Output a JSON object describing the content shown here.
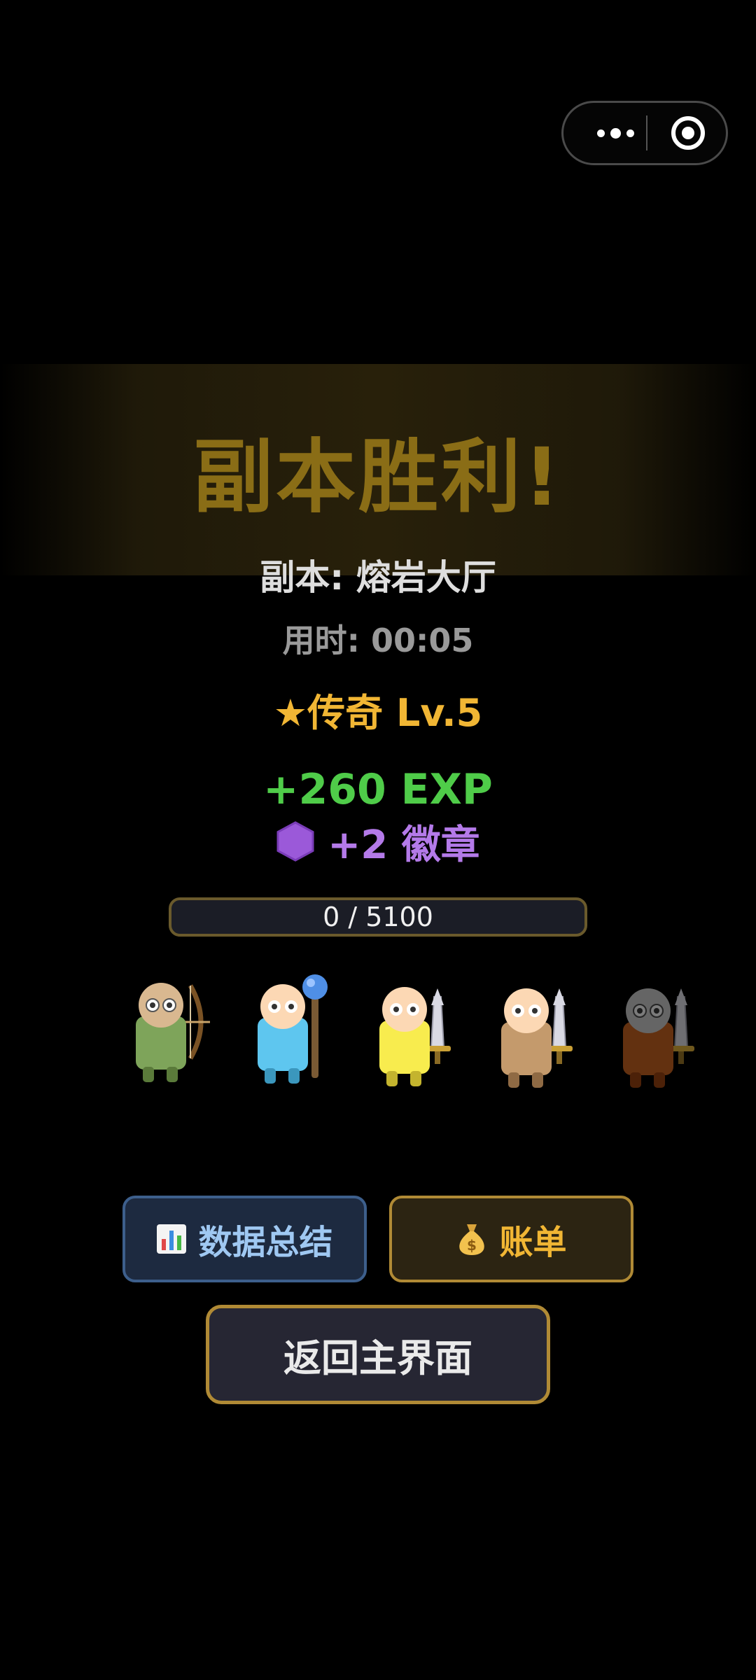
{
  "result": {
    "title": "副本胜利!",
    "dungeon": "副本: 熔岩大厅",
    "time": "用时: 00:05",
    "rank": "★传奇 Lv.5",
    "exp": "+260 EXP",
    "badges": "+2 徽章"
  },
  "progress": {
    "current": 0,
    "max": 5100,
    "label": "0 / 5100"
  },
  "heroes": [
    {
      "class": "archer",
      "body_color": "#7ea45a",
      "weapon": "bow-icon"
    },
    {
      "class": "mage",
      "body_color": "#5ec6ef",
      "weapon": "staff-icon"
    },
    {
      "class": "warrior",
      "body_color": "#f8ec4e",
      "weapon": "sword-icon"
    },
    {
      "class": "warrior",
      "body_color": "#c49a6c",
      "weapon": "sword-icon"
    },
    {
      "class": "warrior",
      "body_color": "#6e3511",
      "weapon": "sword-icon",
      "dimmed": true
    }
  ],
  "buttons": {
    "stats": "数据总结",
    "bill": "账单",
    "home": "返回主界面"
  },
  "colors": {
    "background": "#000000",
    "gold": "#f1b634",
    "exp_green": "#4fcc49",
    "badge_purple": "#b47ae9"
  }
}
